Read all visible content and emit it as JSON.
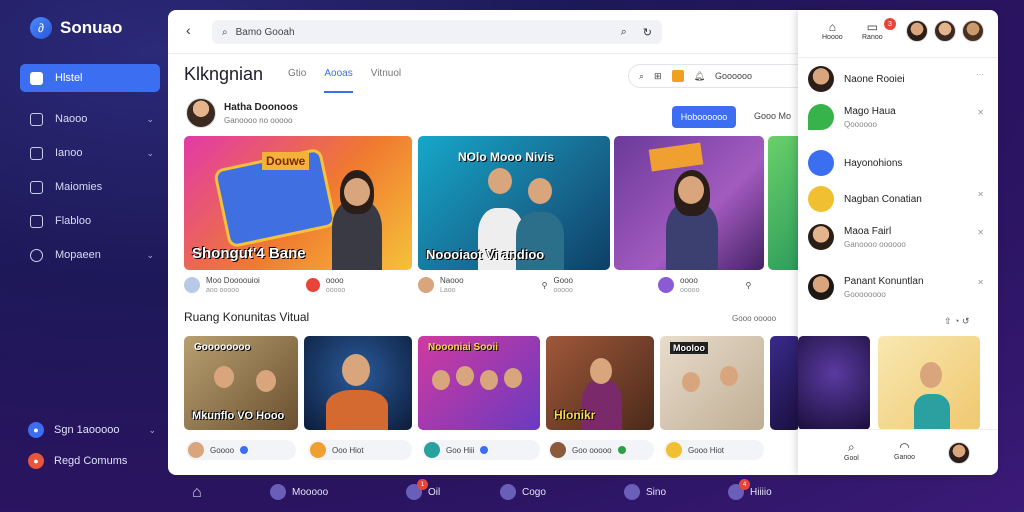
{
  "brand": {
    "name": "Sonuao",
    "logo_glyph": "∂"
  },
  "sidebar": {
    "items": [
      {
        "label": "Hlstel"
      },
      {
        "label": "Naooo"
      },
      {
        "label": "Ianoo"
      },
      {
        "label": "Maiomies"
      },
      {
        "label": "Flabloo"
      },
      {
        "label": "Mopaeen"
      }
    ],
    "bottom": [
      {
        "label": "Sgn 1aooooo"
      },
      {
        "label": "Regd Comums"
      }
    ]
  },
  "topbar": {
    "search_value": "Bamo Gooah"
  },
  "page": {
    "title": "Klkngnian",
    "tabs": [
      "Gtio",
      "Aooas",
      "Vitnuol"
    ],
    "pill_text": "Goooooo"
  },
  "creator": {
    "name": "Hatha Doonoos",
    "sub": "Ganoooo no ooooo",
    "follow": "Hoboooooo",
    "more": "Gooo Mo"
  },
  "featured": [
    {
      "top": "Douwe",
      "caption": "Shongut'4 Bane",
      "meta_title": "Moo Doooouioi",
      "meta_sub": "aoo ooooo"
    },
    {
      "top": "NOlo Mooo Nivis",
      "caption": "Noooiaot Vi andioo",
      "meta_title": "Naooo",
      "meta_sub": "Laoo"
    },
    {
      "top": "",
      "caption": "",
      "meta_title": "oooo",
      "meta_sub": "ooooo"
    },
    {
      "top": "",
      "caption": "",
      "meta_title": "Gooo",
      "meta_sub": "ooooo"
    }
  ],
  "section": {
    "title": "Ruang Konunitas Vitual",
    "right": "Gooo ooooo"
  },
  "community": [
    {
      "top": "Goooooooo",
      "caption": "Mkunflo VO Hooo",
      "meta": "Goooo"
    },
    {
      "top": "",
      "caption": "",
      "meta": "Ooo Hiot"
    },
    {
      "top": "Noooniai Sooii",
      "caption": "",
      "meta": "Goo Hiii"
    },
    {
      "top": "",
      "caption": "Hlonikr",
      "meta": "Goo ooooo"
    },
    {
      "top": "Mooloo",
      "caption": "",
      "meta": "Gooo Hiot"
    }
  ],
  "rpanel": {
    "icons": [
      "Hoooo",
      "Ranoo"
    ],
    "notif_count": "3",
    "contacts": [
      {
        "name": "Naone Rooiei",
        "sub": ""
      },
      {
        "name": "Mago Haua",
        "sub": "Qoooooo"
      },
      {
        "name": "Hayonohions",
        "sub": ""
      },
      {
        "name": "Nagban Conatian",
        "sub": ""
      },
      {
        "name": "Maoa Fairl",
        "sub": "Ganoooo oooooo"
      },
      {
        "name": "Panant Konuntlan",
        "sub": "Goooooooo"
      }
    ],
    "bottom": [
      "Gool",
      "Ganoo"
    ]
  },
  "dock": [
    {
      "label": ""
    },
    {
      "label": "Mooooo"
    },
    {
      "label": "Oil",
      "badge": "1"
    },
    {
      "label": "Cogo"
    },
    {
      "label": "Sino"
    },
    {
      "label": "Hiiiio",
      "badge": "4"
    }
  ]
}
